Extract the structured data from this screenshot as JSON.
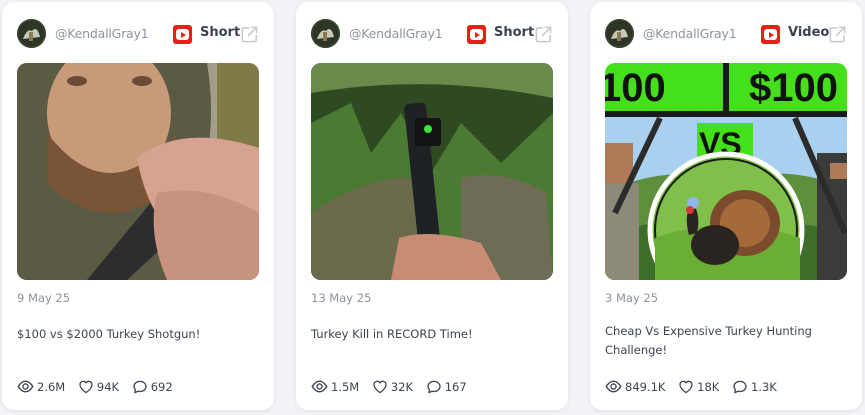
{
  "cards": [
    {
      "handle": "@KendallGray1",
      "type_label": "Short",
      "date": "9 May 25",
      "title": "$100 vs $2000 Turkey Shotgun!",
      "views": "2.6M",
      "likes": "94K",
      "comments": "692"
    },
    {
      "handle": "@KendallGray1",
      "type_label": "Short",
      "date": "13 May 25",
      "title": "Turkey Kill in RECORD Time!",
      "views": "1.5M",
      "likes": "32K",
      "comments": "167"
    },
    {
      "handle": "@KendallGray1",
      "type_label": "Video",
      "date": "3 May 25",
      "title": "Cheap Vs Expensive Turkey Hunting Challenge!",
      "views": "849.1K",
      "likes": "18K",
      "comments": "1.3K",
      "thumb_text_left": "100",
      "thumb_text_right": "$100",
      "thumb_text_vs": "VS"
    }
  ],
  "colors": {
    "youtube_red": "#e62117",
    "thumb_green": "#44e01b"
  },
  "icons": {
    "platform": "youtube-icon",
    "external": "external-link-icon",
    "views": "eye-icon",
    "likes": "heart-icon",
    "comments": "comment-icon"
  }
}
